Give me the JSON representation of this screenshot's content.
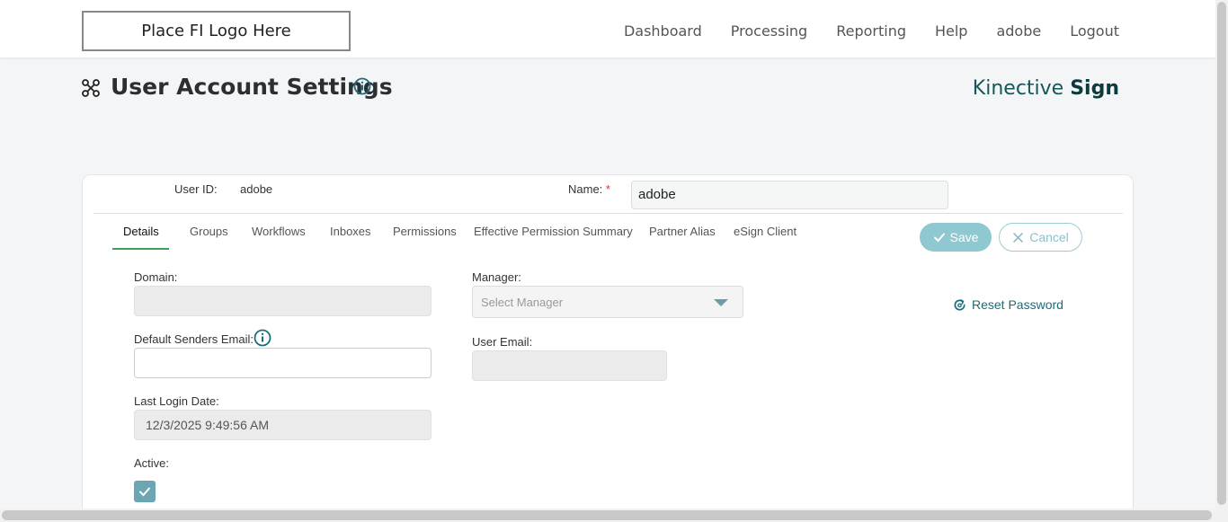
{
  "header": {
    "logo_text": "Place FI Logo Here",
    "nav": [
      "Dashboard",
      "Processing",
      "Reporting",
      "Help",
      "adobe",
      "Logout"
    ]
  },
  "page": {
    "title": "User Account Settings",
    "brand_light": "Kinective",
    "brand_bold": "Sign"
  },
  "user": {
    "id_label": "User ID:",
    "id_value": "adobe",
    "name_label": "Name:",
    "name_required": "*",
    "name_value": "adobe"
  },
  "tabs": [
    "Details",
    "Groups",
    "Workflows",
    "Inboxes",
    "Permissions",
    "Effective Permission Summary",
    "Partner Alias",
    "eSign Client"
  ],
  "active_tab": "Details",
  "buttons": {
    "save": "Save",
    "cancel": "Cancel",
    "reset_password": "Reset Password"
  },
  "form": {
    "domain_label": "Domain:",
    "domain_value": "",
    "manager_label": "Manager:",
    "manager_placeholder": "Select Manager",
    "default_email_label": "Default Senders Email:",
    "default_email_value": "",
    "user_email_label": "User Email:",
    "user_email_value": "",
    "last_login_label": "Last Login Date:",
    "last_login_value": "12/3/2025 9:49:56 AM",
    "active_label": "Active:",
    "active_checked": true
  },
  "colors": {
    "accent_teal": "#1a6c7a",
    "save_button": "#90c8d2",
    "tab_underline": "#3aa05a",
    "brand": "#0c3b3d"
  }
}
